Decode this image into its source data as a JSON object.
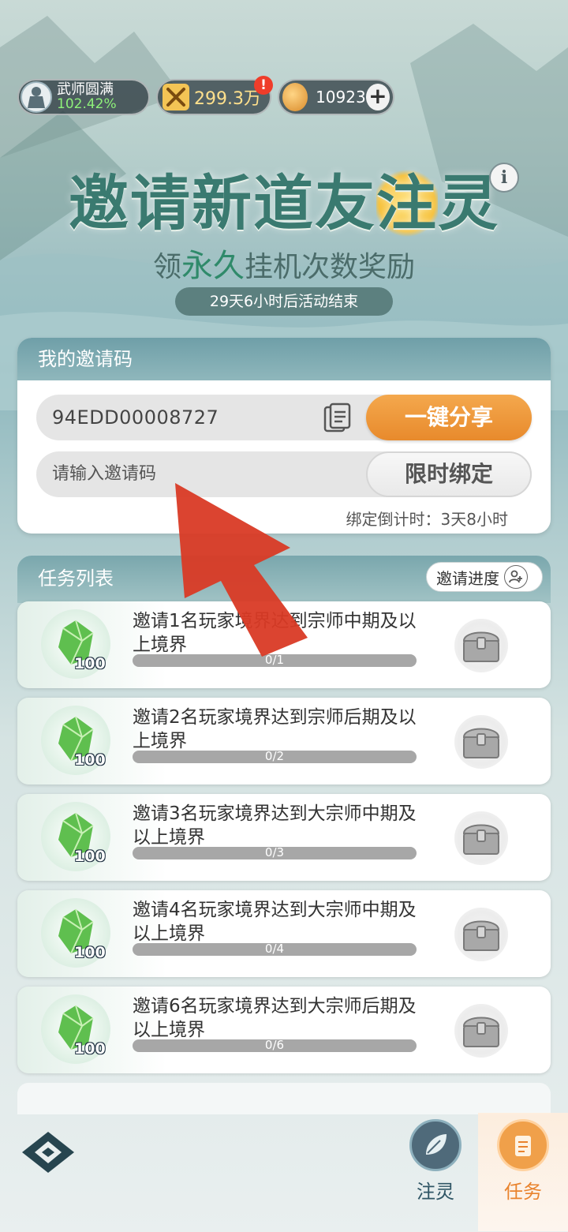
{
  "status_bar": {
    "realm_name": "武师圆满",
    "realm_percent": "102.42%",
    "power": "299.3万",
    "power_alert": "!",
    "currency": "10923",
    "plus_label": "+"
  },
  "header": {
    "title_part1": "邀请新道友",
    "title_highlight": "注",
    "title_part2": "灵",
    "subtitle_part1": "领",
    "subtitle_em": "永久",
    "subtitle_part2": "挂机次数奖励",
    "countdown": "29天6小时后活动结束",
    "info_label": "i"
  },
  "invite": {
    "section_title": "我的邀请码",
    "my_code": "94EDD00008727",
    "share_label": "一键分享",
    "input_placeholder": "请输入邀请码",
    "bind_label": "限时绑定",
    "bind_timer": "绑定倒计时：3天8小时"
  },
  "tasks": {
    "section_title": "任务列表",
    "progress_button": "邀请进度",
    "items": [
      {
        "desc": "邀请1名玩家境界达到宗师中期及以上境界",
        "progress": "0/1",
        "reward_qty": "100",
        "ratio": 0
      },
      {
        "desc": "邀请2名玩家境界达到宗师后期及以上境界",
        "progress": "0/2",
        "reward_qty": "100",
        "ratio": 0
      },
      {
        "desc": "邀请3名玩家境界达到大宗师中期及以上境界",
        "progress": "0/3",
        "reward_qty": "100",
        "ratio": 0
      },
      {
        "desc": "邀请4名玩家境界达到大宗师中期及以上境界",
        "progress": "0/4",
        "reward_qty": "100",
        "ratio": 0
      },
      {
        "desc": "邀请6名玩家境界达到大宗师后期及以上境界",
        "progress": "0/6",
        "reward_qty": "100",
        "ratio": 0
      }
    ]
  },
  "bottom_nav": {
    "items": [
      {
        "label": "注灵",
        "icon": "leaf-icon",
        "active": false
      },
      {
        "label": "任务",
        "icon": "scroll-icon",
        "active": true
      }
    ]
  },
  "colors": {
    "accent_orange": "#e88a2c",
    "header_teal": "#7aa7ad",
    "title_green": "#3a7a70",
    "overlay_arrow": "#d93a25"
  }
}
